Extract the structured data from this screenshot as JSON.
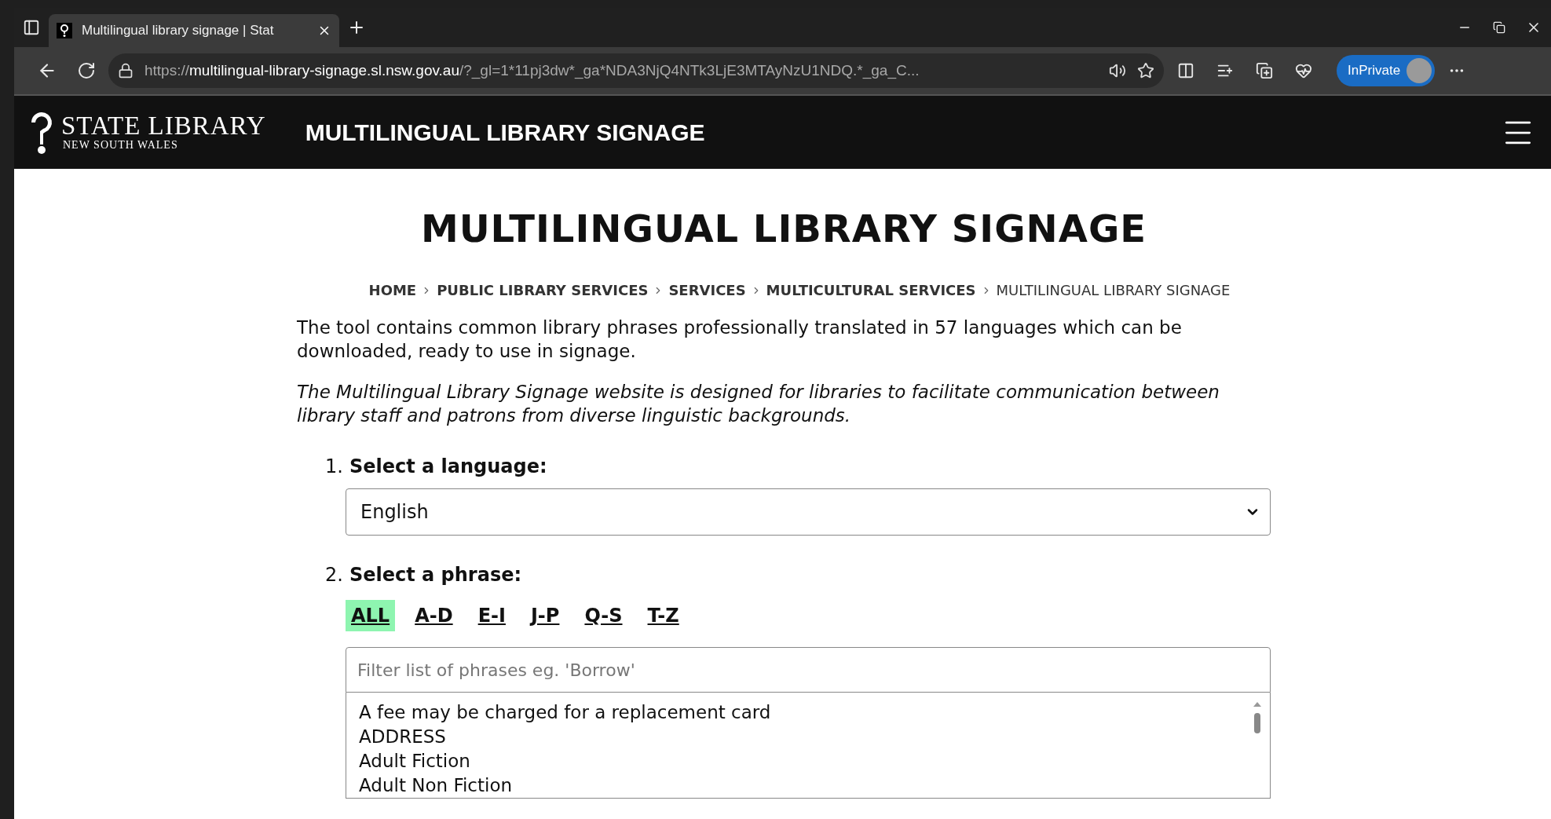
{
  "browser": {
    "tab": {
      "title": "Multilingual library signage | Stat",
      "selected": true
    },
    "url": {
      "scheme": "https://",
      "host": "multilingual-library-signage.sl.nsw.gov.au",
      "rest": "/?_gl=1*11pj3dw*_ga*NDA3NjQ4NTk3LjE3MTAyNzU1NDQ.*_ga_C..."
    },
    "profile_label": "InPrivate"
  },
  "site_header": {
    "logo_title": "STATE LIBRARY",
    "logo_subtitle": "NEW SOUTH WALES",
    "title": "MULTILINGUAL LIBRARY SIGNAGE"
  },
  "page": {
    "heading": "MULTILINGUAL LIBRARY SIGNAGE",
    "breadcrumb": [
      {
        "label": "HOME",
        "current": false
      },
      {
        "label": "PUBLIC LIBRARY SERVICES",
        "current": false
      },
      {
        "label": "SERVICES",
        "current": false
      },
      {
        "label": "MULTICULTURAL SERVICES",
        "current": false
      },
      {
        "label": "MULTILINGUAL LIBRARY SIGNAGE",
        "current": true
      }
    ],
    "intro": "The tool contains common library phrases professionally translated in 57 languages which can be downloaded, ready to use in signage.",
    "note": "The Multilingual Library Signage website is designed for libraries to facilitate communication between library staff and patrons from diverse linguistic backgrounds.",
    "steps": [
      {
        "number": "1.",
        "label": "Select a language:",
        "kind": "select",
        "value": "English"
      },
      {
        "number": "2.",
        "label": "Select a phrase:",
        "kind": "phrases",
        "letter_filters": [
          {
            "label": "ALL",
            "selected": true
          },
          {
            "label": "A-D",
            "selected": false
          },
          {
            "label": "E-I",
            "selected": false
          },
          {
            "label": "J-P",
            "selected": false
          },
          {
            "label": "Q-S",
            "selected": false
          },
          {
            "label": "T-Z",
            "selected": false
          }
        ],
        "filter_placeholder": "Filter list of phrases eg. 'Borrow'",
        "phrases": [
          "A fee may be charged for a replacement card",
          "ADDRESS",
          "Adult Fiction",
          "Adult Non Fiction"
        ]
      }
    ]
  }
}
